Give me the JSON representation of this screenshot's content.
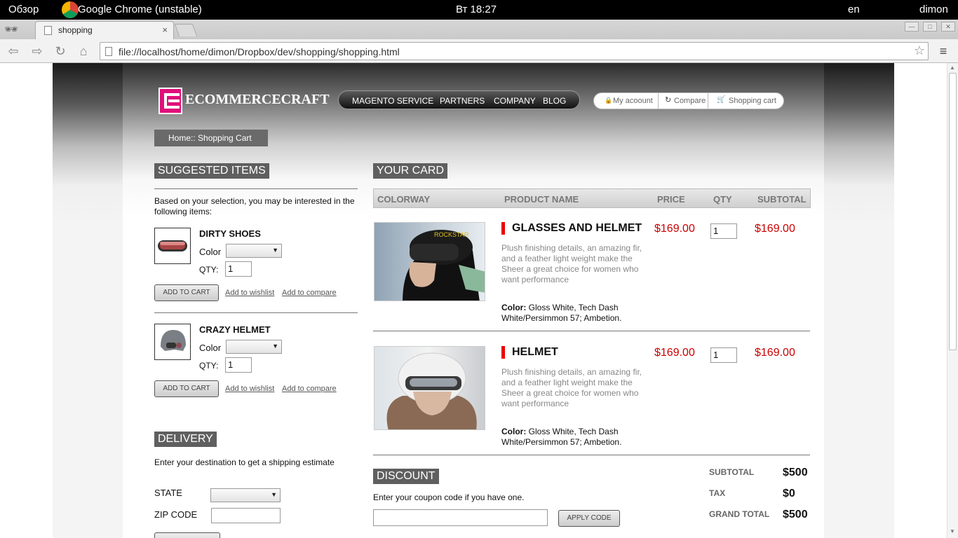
{
  "os_bar": {
    "activities": "Обзор",
    "app_name": "Google Chrome (unstable)",
    "clock": "Вт 18:27",
    "lang": "en",
    "user": "dimon"
  },
  "browser": {
    "tab_title": "shopping",
    "tab_close": "×",
    "url": "file://localhost/home/dimon/Dropbox/dev/shopping/shopping.html"
  },
  "site": {
    "logo_text": "ECOMMERCECRAFT",
    "nav": [
      "MAGENTO SERVICE",
      "PARTNERS",
      "COMPANY",
      "BLOG"
    ],
    "account_links": [
      "My acoount",
      "Compare",
      "Shopping cart"
    ],
    "breadcrumb": "Home:: Shopping Cart"
  },
  "suggested": {
    "heading": "SUGGESTED ITEMS",
    "intro": "Based on your selection, you may be interested in the following items:",
    "items": [
      {
        "name": "DIRTY SHOES",
        "color_label": "Color",
        "qty_label": "QTY:",
        "qty": "1",
        "add_to_cart": "ADD TO CART",
        "wishlist": "Add to wishlist",
        "compare": "Add to compare"
      },
      {
        "name": "CRAZY HELMET",
        "color_label": "Color",
        "qty_label": "QTY:",
        "qty": "1",
        "add_to_cart": "ADD TO CART",
        "wishlist": "Add to wishlist",
        "compare": "Add to compare"
      }
    ]
  },
  "delivery": {
    "heading": "DELIVERY",
    "intro": "Enter your destination to get a shipping estimate",
    "state_label": "STATE",
    "zip_label": "ZIP CODE"
  },
  "cart": {
    "heading": "YOUR CARD",
    "columns": [
      "COLORWAY",
      "PRODUCT NAME",
      "PRICE",
      "QTY",
      "SUBTOTAL"
    ],
    "items": [
      {
        "name": "GLASSES AND HELMET",
        "price": "$169.00",
        "qty": "1",
        "subtotal": "$169.00",
        "desc": "Plush finishing details, an amazing fir, and a feather light weight make the Sheer a great choice for women who want performance",
        "color_label": "Color:",
        "color": "Gloss White, Tech Dash White/Persimmon 57; Ambetion."
      },
      {
        "name": "HELMET",
        "price": "$169.00",
        "qty": "1",
        "subtotal": "$169.00",
        "desc": "Plush finishing details, an amazing fir, and a feather light weight make the Sheer a great choice for women who want performance",
        "color_label": "Color:",
        "color": "Gloss White, Tech Dash White/Persimmon 57; Ambetion."
      }
    ]
  },
  "discount": {
    "heading": "DISCOUNT",
    "intro": "Enter your coupon code if you have one.",
    "apply": "APPLY CODE"
  },
  "totals": {
    "subtotal_label": "SUBTOTAL",
    "subtotal": "$500",
    "tax_label": "TAX",
    "tax": "$0",
    "grand_label": "GRAND TOTAL",
    "grand": "$500"
  },
  "colors": {
    "accent_red": "#cc0000",
    "logo_pink": "#e0107a",
    "header_gray": "#5f5f5f"
  }
}
